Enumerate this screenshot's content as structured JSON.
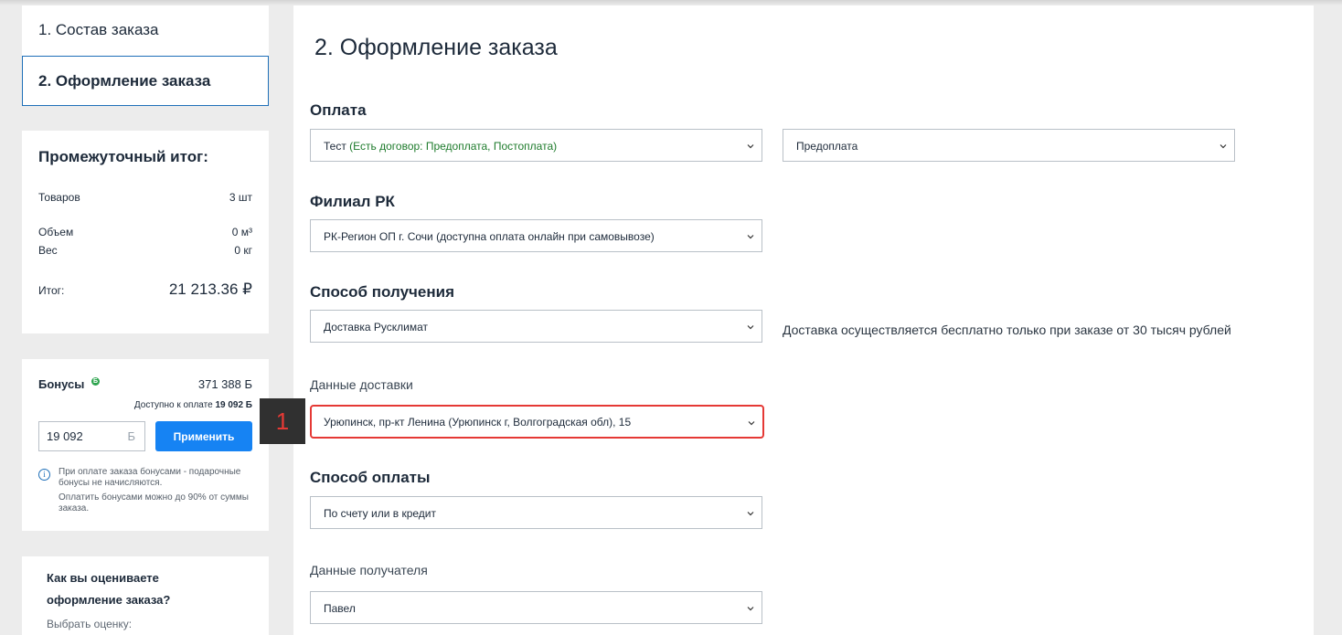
{
  "steps": {
    "step1": "1. Состав заказа",
    "step2": "2. Оформление заказа"
  },
  "subtotal": {
    "title": "Промежуточный итог:",
    "goods_label": "Товаров",
    "goods_value": "3 шт",
    "volume_label": "Объем",
    "volume_value": "0 м³",
    "weight_label": "Вес",
    "weight_value": "0 кг",
    "total_label": "Итог:",
    "total_value": "21 213.36 ₽"
  },
  "bonus": {
    "label": "Бонусы",
    "badge": "Б",
    "amount": "371 388 Б",
    "available_prefix": "Доступно к оплате ",
    "available_value": "19 092 Б",
    "input_value": "19 092",
    "input_currency": "Б",
    "apply_label": "Применить",
    "note1": "При оплате заказа бонусами - подарочные бонусы не начисляются.",
    "note2": "Оплатить бонусами можно до 90% от суммы заказа."
  },
  "rating": {
    "question": "Как вы оцениваете оформление заказа?",
    "sub": "Выбрать оценку:"
  },
  "main": {
    "title": "2. Оформление заказа",
    "payment_title": "Оплата",
    "payment_select_main": "Тест ",
    "payment_select_contract": "(Есть договор: Предоплата, Постоплата)",
    "payment_type": "Предоплата",
    "branch_title": "Филиал РК",
    "branch_select": "РК-Регион ОП г. Сочи (доступна оплата онлайн при самовывозе)",
    "receive_title": "Способ получения",
    "receive_select": "Доставка Русклимат",
    "receive_note": "Доставка осуществляется бесплатно только при заказе от 30 тысяч рублей",
    "delivery_title": "Данные доставки",
    "delivery_select": "Урюпинск, пр-кт Ленина (Урюпинск г, Волгоградская обл), 15",
    "paymethod_title": "Способ оплаты",
    "paymethod_select": "По счету или в кредит",
    "recipient_title": "Данные получателя",
    "recipient_select": "Павел"
  },
  "marker": {
    "label": "1",
    "color": "#e53935"
  },
  "colors": {
    "accent": "#1683f3",
    "highlight": "#e53935",
    "contract_green": "#1e7b2c"
  },
  "icons": {
    "chevron": "chevron-down-icon",
    "info": "info-icon",
    "bonus": "bonus-badge-icon"
  }
}
